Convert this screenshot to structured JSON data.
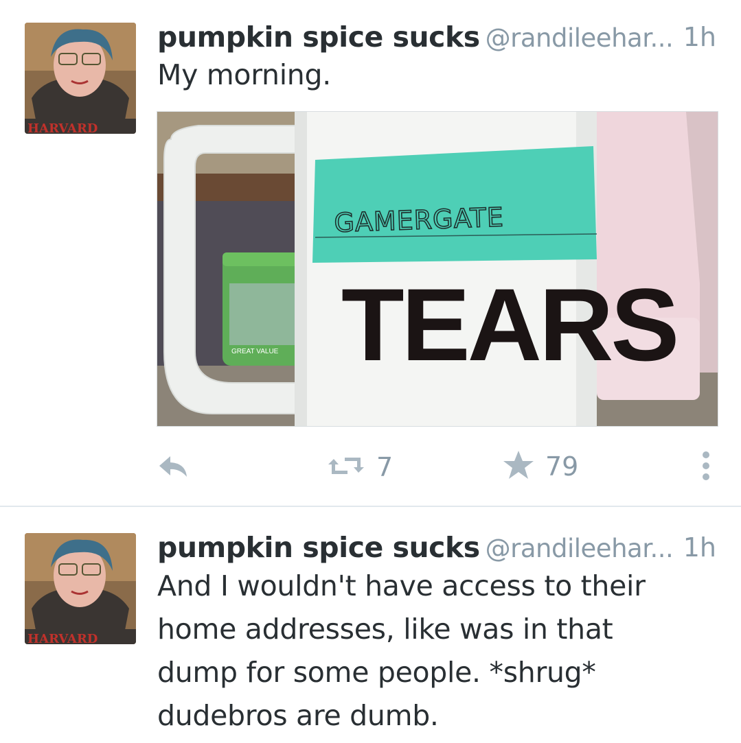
{
  "tweets": [
    {
      "name": "pumpkin spice sucks",
      "handle": "@randileehar...",
      "time": "1h",
      "text": "My morning.",
      "media": {
        "label_handwritten": "GAMERGATE",
        "mug_text": "TEARS",
        "jar_text": "GREAT VALUE"
      },
      "actions": {
        "reply_icon": "reply-icon",
        "retweet_icon": "retweet-icon",
        "retweets": "7",
        "favorite_icon": "star-icon",
        "favorites": "79",
        "more_icon": "more-vertical-icon"
      }
    },
    {
      "name": "pumpkin spice sucks",
      "handle": "@randileehar...",
      "time": "1h",
      "text": "And I wouldn't have access to their\nhome addresses, like was in that\ndump for some people. *shrug*\ndudebros are dumb."
    }
  ],
  "avatar": {
    "sweatshirt_text": "HARVARD"
  },
  "colors": {
    "text": "#292f33",
    "secondary": "#8899a6",
    "icon": "#aab8c2",
    "divider": "#e1e8ed",
    "tape": "#4ecfb6"
  }
}
